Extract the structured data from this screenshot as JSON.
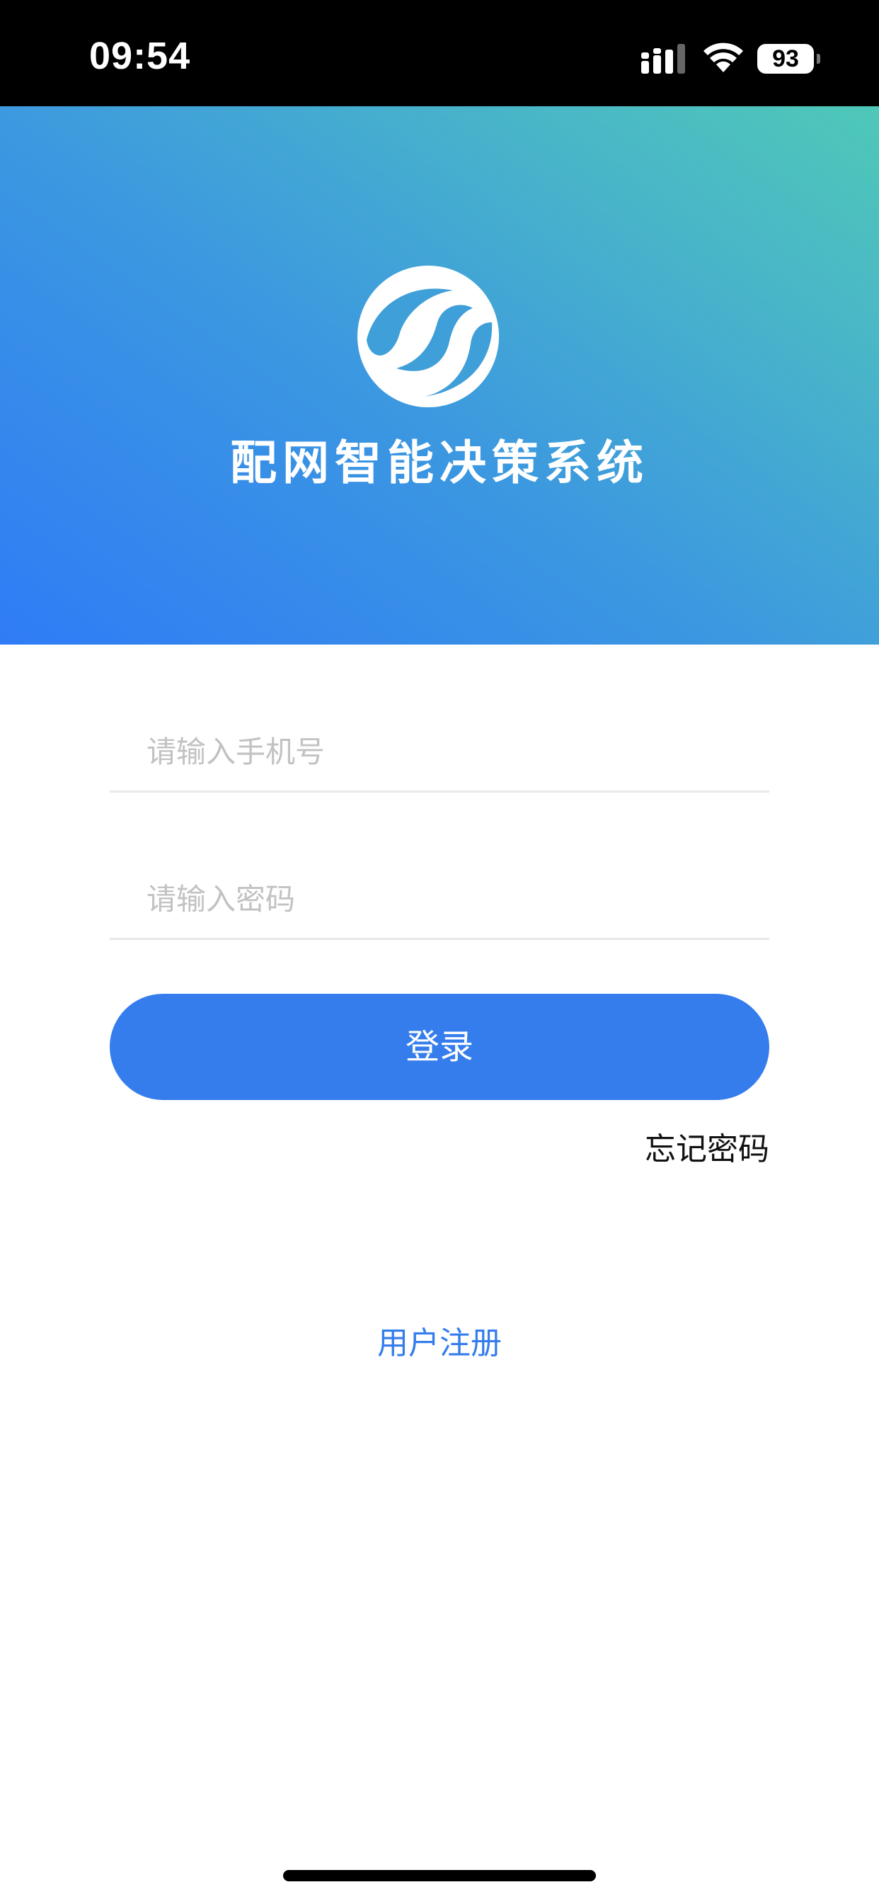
{
  "status_bar": {
    "time": "09:54",
    "battery_level": "93"
  },
  "app": {
    "title": "配网智能决策系统"
  },
  "form": {
    "phone_placeholder": "请输入手机号",
    "phone_value": "",
    "password_placeholder": "请输入密码",
    "password_value": "",
    "login_label": "登录",
    "forgot_password_label": "忘记密码"
  },
  "footer": {
    "register_label": "用户注册"
  },
  "colors": {
    "accent": "#357dec",
    "gradient_start": "#2f7cf6",
    "gradient_end": "#4ec8b8",
    "placeholder": "#c2c2c2"
  },
  "icons": [
    "signal-icon",
    "wifi-icon",
    "battery-icon",
    "app-logo-icon"
  ]
}
